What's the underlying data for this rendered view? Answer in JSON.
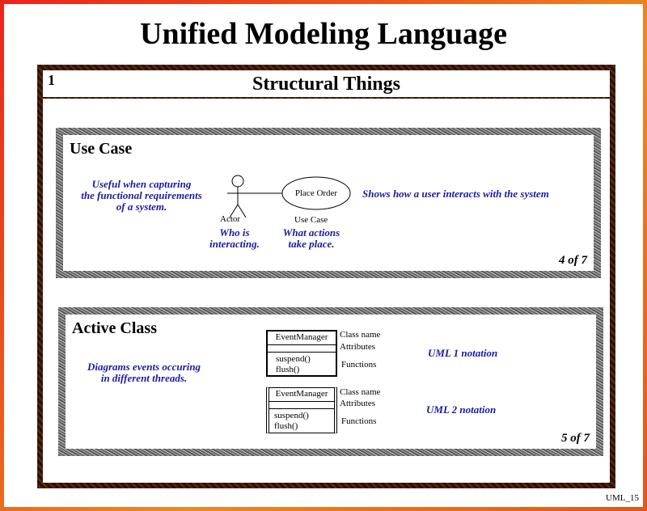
{
  "title": "Unified Modeling Language",
  "slide_number": "1",
  "section_title": "Structural Things",
  "use_case": {
    "heading": "Use Case",
    "left_note": [
      "Useful when capturing",
      "the functional requirements",
      "of a system."
    ],
    "actor_label": "Actor",
    "usecase_name": "Place Order",
    "usecase_label": "Use Case",
    "actor_note": [
      "Who is",
      "interacting."
    ],
    "usecase_note": [
      "What actions",
      "take place."
    ],
    "right_note": "Shows how a user interacts with the system",
    "page": "4 of 7"
  },
  "active_class": {
    "heading": "Active Class",
    "left_note": [
      "Diagrams events occuring",
      "in different threads."
    ],
    "uml1": {
      "class_name": "EventManager",
      "ops": [
        "suspend()",
        "flush()"
      ],
      "label_name": "Class name",
      "label_attr": "Attributes",
      "label_func": "Functions",
      "notation": "UML 1 notation"
    },
    "uml2": {
      "class_name": "EventManager",
      "ops": [
        "suspend()",
        "flush()"
      ],
      "label_name": "Class name",
      "label_attr": "Attributes",
      "label_func": "Functions",
      "notation": "UML 2 notation"
    },
    "page": "5 of 7"
  },
  "footer": "UML_15",
  "colors": {
    "accent_text": "#1a1aa0",
    "frame": "#e8261c",
    "panel": "#3a1a0e"
  }
}
